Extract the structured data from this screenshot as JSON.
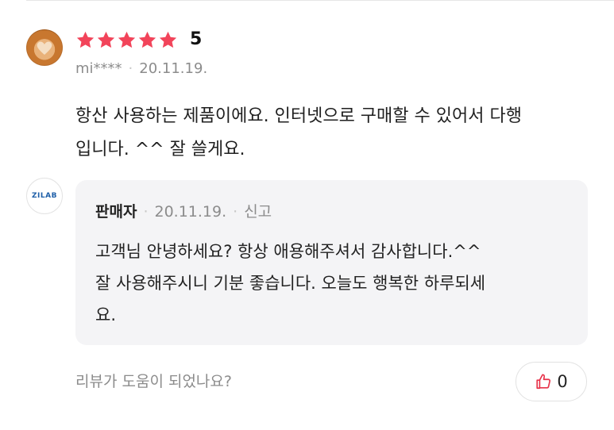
{
  "review": {
    "rating_value": "5",
    "stars": 5,
    "star_color": "#f2445a",
    "user": "mi****",
    "date": "20.11.19.",
    "text_line1": "항산 사용하는 제품이에요. 인터넷으로 구매할 수 있어서 다행",
    "text_line2": "입니다. ^^ 잘 쓸게요."
  },
  "seller": {
    "logo_text": "ZILAB",
    "name": "판매자",
    "date": "20.11.19.",
    "report_label": "신고",
    "reply_line1": "고객님 안녕하세요? 항상 애용해주셔서 감사합니다.^^",
    "reply_line2": "잘 사용해주시니 기분 좋습니다. 오늘도 행복한 하루되세",
    "reply_line3": "요."
  },
  "helpful": {
    "question": "리뷰가 도움이 되었나요?",
    "like_count": "0",
    "like_icon_color": "#e8334a"
  }
}
